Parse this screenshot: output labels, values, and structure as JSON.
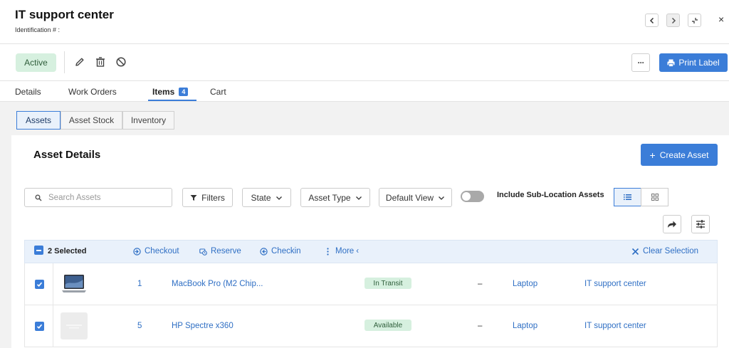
{
  "header": {
    "title": "IT support center",
    "identification_label": "Identification # :",
    "close_glyph": "×"
  },
  "action_bar": {
    "status": "Active",
    "more_label": "···",
    "print_label": "Print Label"
  },
  "tabs": [
    {
      "label": "Details"
    },
    {
      "label": "Work Orders"
    },
    {
      "label": "Items",
      "badge": "4",
      "active": true
    },
    {
      "label": "Cart"
    }
  ],
  "subtabs": [
    {
      "label": "Assets",
      "active": true
    },
    {
      "label": "Asset Stock"
    },
    {
      "label": "Inventory"
    }
  ],
  "panel": {
    "title": "Asset Details",
    "create_label": "Create Asset"
  },
  "toolbar": {
    "search_placeholder": "Search Assets",
    "filters_label": "Filters",
    "state_label": "State",
    "asset_type_label": "Asset Type",
    "view_label": "Default View",
    "include_sub_label": "Include Sub-Location Assets",
    "include_sub_on": false
  },
  "selection": {
    "count_label": "2 Selected",
    "checkout": "Checkout",
    "reserve": "Reserve",
    "checkin": "Checkin",
    "more": "More",
    "more_chevron": "‹",
    "clear": "Clear Selection"
  },
  "rows": [
    {
      "id": "1",
      "name": "MacBook Pro (M2 Chip...",
      "status": "In Transit",
      "dash": "–",
      "type": "Laptop",
      "location": "IT support center",
      "checked": true
    },
    {
      "id": "5",
      "name": "HP Spectre x360",
      "status": "Available",
      "dash": "–",
      "type": "Laptop",
      "location": "IT support center",
      "checked": true
    }
  ],
  "colors": {
    "accent": "#3b7dd8",
    "status_bg": "#d6f0df",
    "status_text": "#2f5e3b"
  }
}
